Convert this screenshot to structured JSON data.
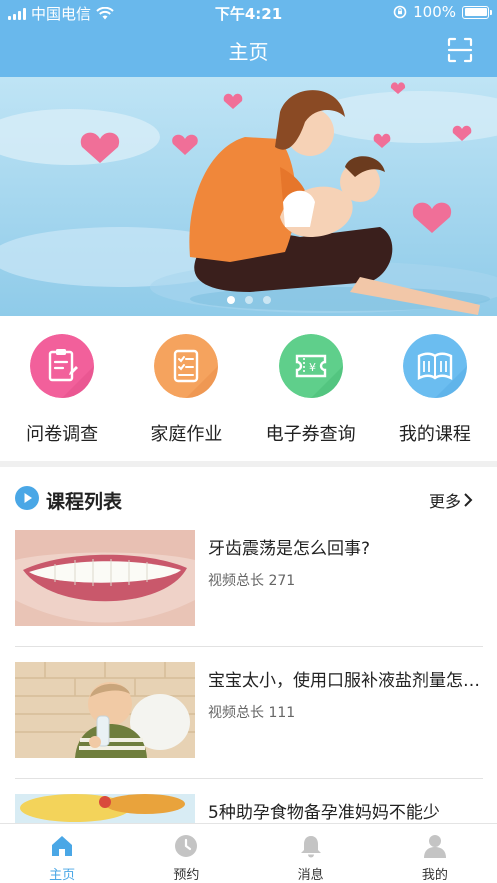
{
  "status_bar": {
    "carrier": "中国电信",
    "time": "下午4:21",
    "battery": "100%",
    "battery_level": 1.0
  },
  "nav": {
    "title": "主页",
    "scan_icon": "scan-icon"
  },
  "banner": {
    "slide_count": 3,
    "active_index": 0
  },
  "quick_actions": [
    {
      "label": "问卷调查",
      "icon": "clipboard-icon",
      "color": "#f2609b"
    },
    {
      "label": "家庭作业",
      "icon": "checklist-icon",
      "color": "#f5a35e"
    },
    {
      "label": "电子券查询",
      "icon": "ticket-icon",
      "color": "#5fcf8b"
    },
    {
      "label": "我的课程",
      "icon": "book-icon",
      "color": "#6bbdf0"
    }
  ],
  "course_section": {
    "title": "课程列表",
    "more_label": "更多",
    "accent": "#4aa7e6"
  },
  "courses": [
    {
      "title": "牙齿震荡是怎么回事?",
      "meta": "视频总长 271",
      "thumb": "teeth-photo"
    },
    {
      "title": "宝宝太小，使用口服补液盐剂量怎么算",
      "meta": "视频总长 111",
      "thumb": "baby-photo"
    },
    {
      "title": "5种助孕食物备孕准妈妈不能少",
      "meta": "",
      "thumb": "food-photo"
    }
  ],
  "tabbar": {
    "items": [
      {
        "label": "主页",
        "icon": "home-icon",
        "active": true
      },
      {
        "label": "预约",
        "icon": "clock-icon",
        "active": false
      },
      {
        "label": "消息",
        "icon": "bell-icon",
        "active": false
      },
      {
        "label": "我的",
        "icon": "person-icon",
        "active": false
      }
    ],
    "active_color": "#4aa7e6",
    "inactive_color": "#c4c4c4"
  }
}
